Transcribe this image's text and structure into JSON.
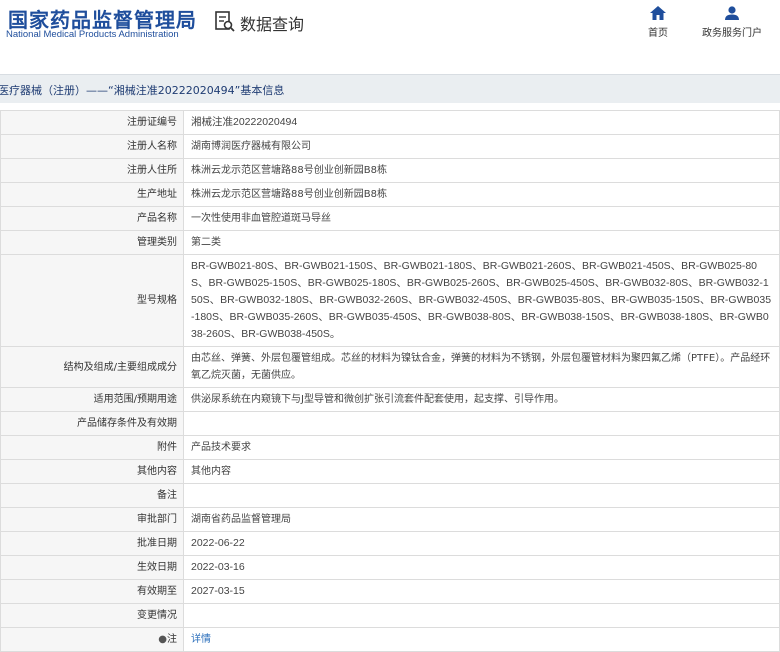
{
  "header": {
    "logo_cn": "国家药品监督管理局",
    "logo_en": "National Medical Products Administration",
    "query_label": "数据查询",
    "nav": [
      {
        "label": "首页",
        "icon": "home-icon"
      },
      {
        "label": "政务服务门户",
        "icon": "user-icon"
      }
    ]
  },
  "title": "医疗器械（注册）——“湘械注准20222020494”基本信息",
  "rows": [
    {
      "label": "注册证编号",
      "value": "湘械注准20222020494"
    },
    {
      "label": "注册人名称",
      "value": "湖南博润医疗器械有限公司"
    },
    {
      "label": "注册人住所",
      "value": "株洲云龙示范区营塘路88号创业创新园B8栋"
    },
    {
      "label": "生产地址",
      "value": "株洲云龙示范区营塘路88号创业创新园B8栋"
    },
    {
      "label": "产品名称",
      "value": "一次性使用非血管腔道斑马导丝"
    },
    {
      "label": "管理类别",
      "value": "第二类"
    },
    {
      "label": "型号规格",
      "value": "BR-GWB021-80S、BR-GWB021-150S、BR-GWB021-180S、BR-GWB021-260S、BR-GWB021-450S、BR-GWB025-80S、BR-GWB025-150S、BR-GWB025-180S、BR-GWB025-260S、BR-GWB025-450S、BR-GWB032-80S、BR-GWB032-150S、BR-GWB032-180S、BR-GWB032-260S、BR-GWB032-450S、BR-GWB035-80S、BR-GWB035-150S、BR-GWB035-180S、BR-GWB035-260S、BR-GWB035-450S、BR-GWB038-80S、BR-GWB038-150S、BR-GWB038-180S、BR-GWB038-260S、BR-GWB038-450S。"
    },
    {
      "label": "结构及组成/主要组成成分",
      "value": "由芯丝、弹簧、外层包覆管组成。芯丝的材料为镍钛合金，弹簧的材料为不锈钢，外层包覆管材料为聚四氟乙烯（PTFE）。产品经环氧乙烷灭菌，无菌供应。"
    },
    {
      "label": "适用范围/预期用途",
      "value": "供泌尿系统在内窥镜下与J型导管和微创扩张引流套件配套使用，起支撑、引导作用。"
    },
    {
      "label": "产品储存条件及有效期",
      "value": ""
    },
    {
      "label": "附件",
      "value": "产品技术要求"
    },
    {
      "label": "其他内容",
      "value": "其他内容"
    },
    {
      "label": "备注",
      "value": ""
    },
    {
      "label": "审批部门",
      "value": "湖南省药品监督管理局"
    },
    {
      "label": "批准日期",
      "value": "2022-06-22"
    },
    {
      "label": "生效日期",
      "value": "2022-03-16"
    },
    {
      "label": "有效期至",
      "value": "2027-03-15"
    },
    {
      "label": "变更情况",
      "value": ""
    },
    {
      "label": "注",
      "value": "详情"
    }
  ],
  "colors": {
    "brand_blue": "#1f4e9c",
    "link": "#2a6ebb"
  }
}
